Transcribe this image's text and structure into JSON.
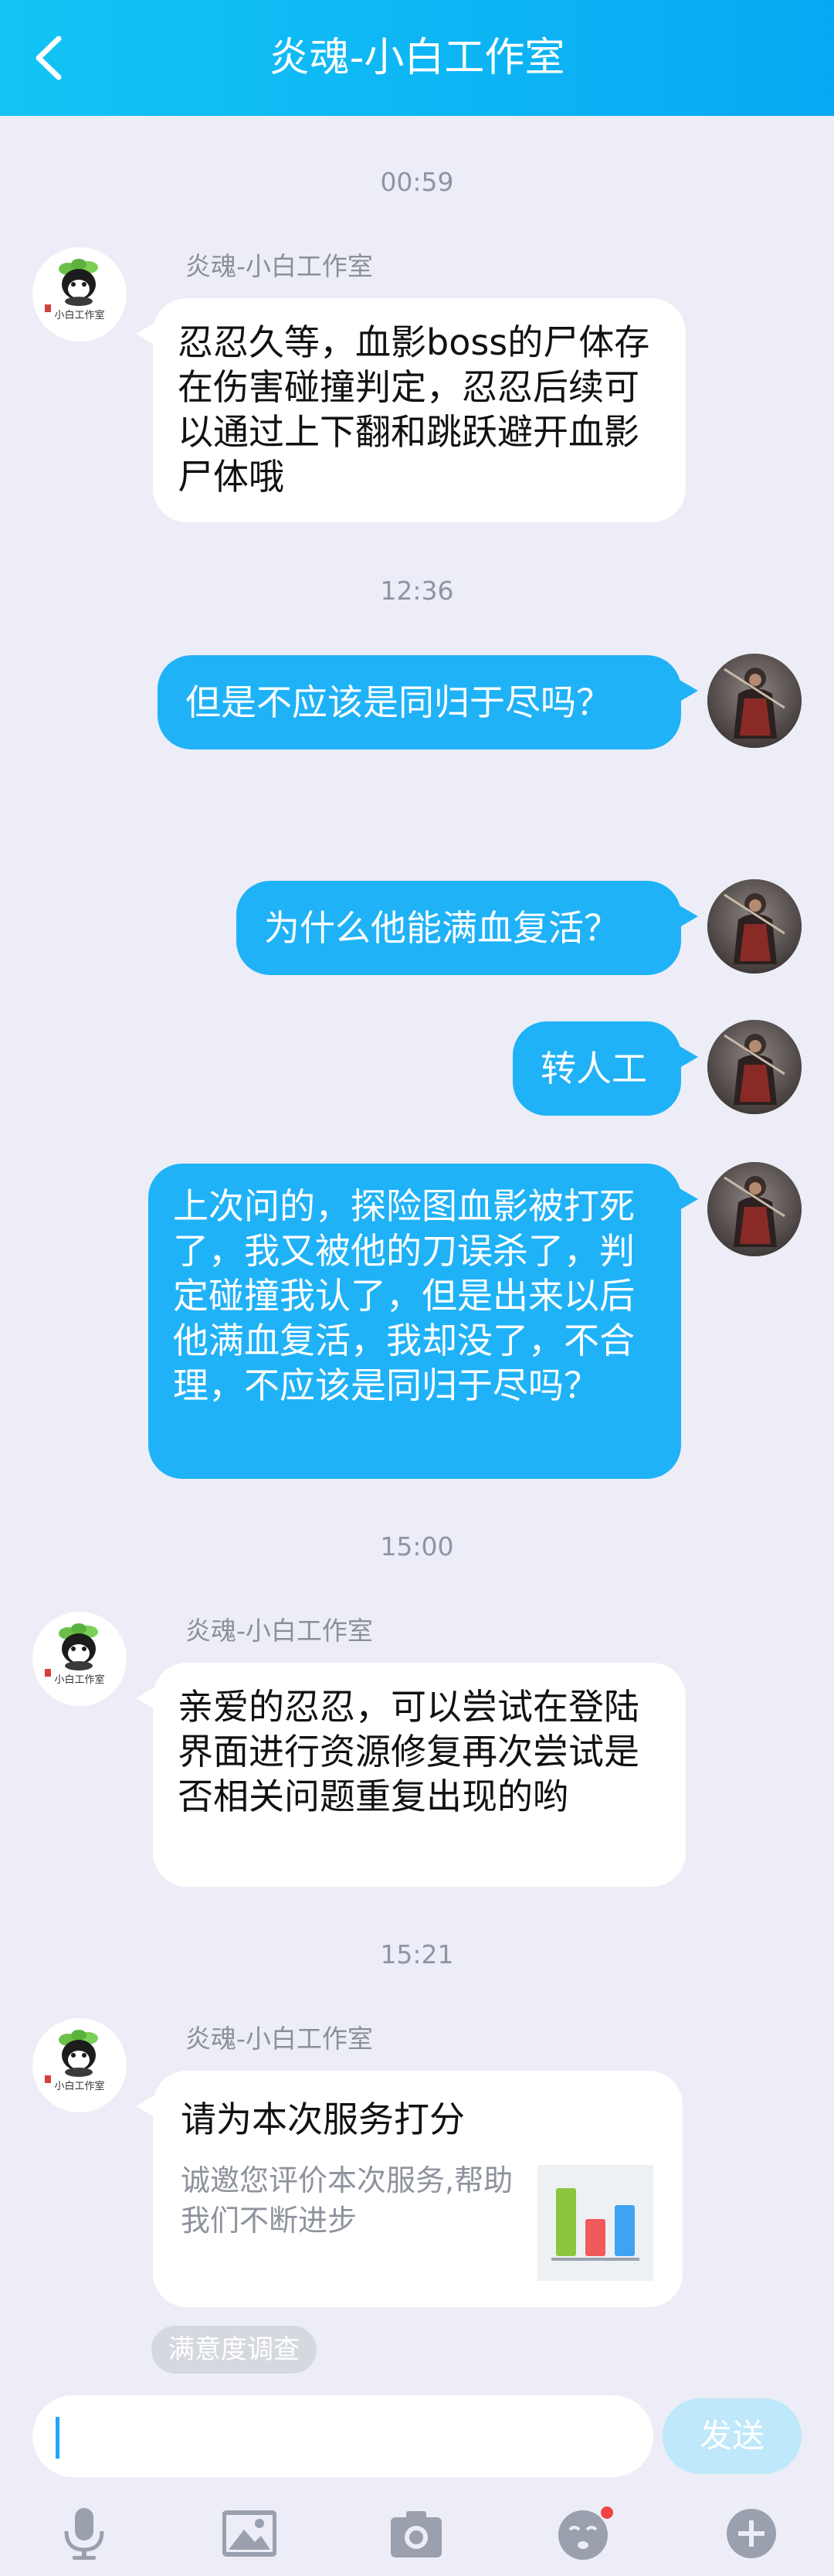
{
  "header": {
    "title": "炎魂-小白工作室"
  },
  "colors": {
    "header_start": "#13c4f5",
    "header_end": "#08a9f3",
    "out_bubble": "#20b2f7",
    "send_disabled": "#bfe8fb",
    "badge_dot": "#f24444"
  },
  "icons": [
    "back-arrow-icon",
    "microphone-icon",
    "image-icon",
    "camera-icon",
    "emoji-icon",
    "plus-icon"
  ],
  "messages": [
    {
      "time": "00:59"
    },
    {
      "sender": "炎魂-小白工作室",
      "text": "忍忍久等，血影boss的尸体存在伤害碰撞判定，忍忍后续可以通过上下翻和跳跃避开血影尸体哦"
    },
    {
      "time": "12:36"
    },
    {
      "text": "但是不应该是同归于尽吗？"
    },
    {
      "text": "为什么他能满血复活？"
    },
    {
      "text": "转人工"
    },
    {
      "text": "上次问的，探险图血影被打死了，我又被他的刀误杀了，判定碰撞我认了，但是出来以后他满血复活，我却没了，不合理，不应该是同归于尽吗？"
    },
    {
      "time": "15:00"
    },
    {
      "sender": "炎魂-小白工作室",
      "text": "亲爱的忍忍，可以尝试在登陆界面进行资源修复再次尝试是否相关问题重复出现的哟"
    },
    {
      "time": "15:21"
    },
    {
      "sender": "炎魂-小白工作室",
      "card_title": "请为本次服务打分",
      "card_desc": "诚邀您评价本次服务,帮助我们不断进步"
    }
  ],
  "survey_tag": "满意度调查",
  "input": {
    "value": "",
    "send_label": "发送"
  }
}
